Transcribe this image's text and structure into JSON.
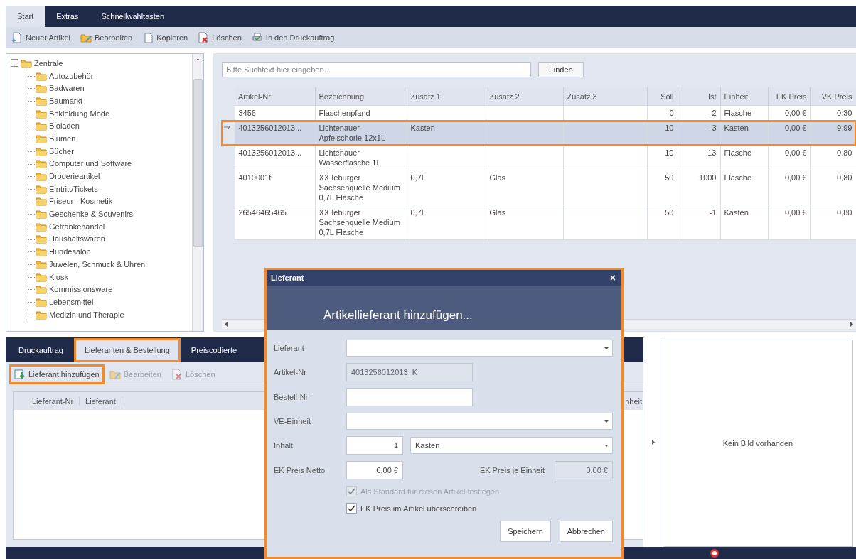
{
  "ribbon_tabs": [
    {
      "label": "Start",
      "selected": true
    },
    {
      "label": "Extras",
      "selected": false
    },
    {
      "label": "Schnellwahltasten",
      "selected": false
    }
  ],
  "toolbar": [
    {
      "label": "Neuer Artikel",
      "kind": "new"
    },
    {
      "label": "Bearbeiten",
      "kind": "edit"
    },
    {
      "label": "Kopieren",
      "kind": "copy"
    },
    {
      "label": "Löschen",
      "kind": "delete"
    },
    {
      "label": "In den Druckauftrag",
      "kind": "print"
    }
  ],
  "tree": [
    {
      "label": "Zentrale",
      "expanded": true,
      "children": [
        {
          "label": "Autozubehör"
        },
        {
          "label": "Badwaren"
        },
        {
          "label": "Baumarkt"
        },
        {
          "label": "Bekleidung Mode"
        },
        {
          "label": "Bioladen"
        },
        {
          "label": "Blumen"
        },
        {
          "label": "Bücher"
        },
        {
          "label": "Computer und Software"
        },
        {
          "label": "Drogerieartikel"
        },
        {
          "label": "Eintritt/Tickets"
        },
        {
          "label": "Friseur - Kosmetik"
        },
        {
          "label": "Geschenke & Souvenirs"
        },
        {
          "label": "Getränkehandel"
        },
        {
          "label": "Haushaltswaren"
        },
        {
          "label": "Hundesalon"
        },
        {
          "label": "Juwelen, Schmuck & Uhren"
        },
        {
          "label": "Kiosk"
        },
        {
          "label": "Kommissionsware"
        },
        {
          "label": "Lebensmittel"
        },
        {
          "label": "Medizin und Therapie"
        }
      ]
    }
  ],
  "search": {
    "placeholder": "Bitte Suchtext hier eingeben...",
    "button": "Finden"
  },
  "articles": {
    "columns": [
      {
        "label": "Artikel-Nr",
        "kind": "text"
      },
      {
        "label": "Bezeichnung",
        "kind": "text"
      },
      {
        "label": "Zusatz 1",
        "kind": "text"
      },
      {
        "label": "Zusatz 2",
        "kind": "text"
      },
      {
        "label": "Zusatz 3",
        "kind": "text"
      },
      {
        "label": "Soll",
        "kind": "number"
      },
      {
        "label": "Ist",
        "kind": "number"
      },
      {
        "label": "Einheit",
        "kind": "text"
      },
      {
        "label": "EK Preis",
        "kind": "number"
      },
      {
        "label": "VK Preis",
        "kind": "number"
      }
    ],
    "rows": [
      {
        "selected": false,
        "highlighted": false,
        "cells": [
          "3456",
          "Flaschenpfand",
          null,
          null,
          null,
          "0",
          "-2",
          "Flasche",
          "0,00 €",
          "0,30"
        ]
      },
      {
        "selected": true,
        "highlighted": true,
        "cells": [
          "4013256012013...",
          "Lichtenauer Apfelschorle 12x1L",
          "Kasten",
          null,
          null,
          "10",
          "-3",
          "Kasten",
          "0,00 €",
          "9,99"
        ]
      },
      {
        "selected": false,
        "highlighted": false,
        "cells": [
          "4013256012013...",
          "Lichtenauer Wasserflasche 1L",
          null,
          null,
          null,
          "10",
          "13",
          "Flasche",
          "0,00 €",
          "0,80"
        ]
      },
      {
        "selected": false,
        "highlighted": false,
        "cells": [
          "4010001f",
          "XX Ieburger Sachsenquelle Medium 0,7L Flasche",
          "0,7L",
          "Glas",
          null,
          "50",
          "1000",
          "Flasche",
          "0,00 €",
          "0,80"
        ]
      },
      {
        "selected": false,
        "highlighted": false,
        "cells": [
          "26546465465",
          "XX Ieburger Sachsenquelle Medium 0,7L Flasche",
          "0,7L",
          "Glas",
          null,
          "50",
          "-1",
          "Kasten",
          "0,00 €",
          "0,80"
        ]
      }
    ]
  },
  "detail_tabs": [
    {
      "label": "Druckauftrag",
      "selected": false,
      "highlighted": false
    },
    {
      "label": "Lieferanten & Bestellung",
      "selected": true,
      "highlighted": true
    },
    {
      "label": "Preiscodierte",
      "selected": false,
      "highlighted": false
    }
  ],
  "detail_toolbar": [
    {
      "label": "Lieferant hinzufügen",
      "kind": "add",
      "disabled": false,
      "highlighted": true
    },
    {
      "label": "Bearbeiten",
      "kind": "edit",
      "disabled": true,
      "highlighted": false
    },
    {
      "label": "Löschen",
      "kind": "delete",
      "disabled": true,
      "highlighted": false
    }
  ],
  "supplier_table": {
    "columns": [
      "Lieferant-Nr",
      "Lieferant",
      "nheit"
    ]
  },
  "image_panel": {
    "text": "Kein Bild vorhanden"
  },
  "dialog": {
    "title": "Lieferant",
    "close": "×",
    "heading": "Artikellieferant hinzufügen...",
    "highlighted": true,
    "fields": [
      {
        "kind": "combo",
        "label": "Lieferant"
      },
      {
        "kind": "text",
        "label": "Artikel-Nr",
        "value": "4013256012013_K",
        "disabled": true
      },
      {
        "kind": "text",
        "label": "Bestell-Nr",
        "disabled": false
      },
      {
        "kind": "combo",
        "label": "VE-Einheit"
      },
      {
        "kind": "quantity",
        "label": "Inhalt",
        "value": "1",
        "unit": "Kasten"
      },
      {
        "kind": "price",
        "label": "EK Preis Netto",
        "value": "0,00 €",
        "unit_label": "EK Preis je Einheit",
        "unit_value": "0,00 €",
        "unit_disabled": true
      }
    ],
    "checkboxes": [
      {
        "label": "Als Standard für diesen Artikel festlegen",
        "checked": true,
        "disabled": true
      },
      {
        "label": "EK Preis im Artikel überschreiben",
        "checked": true,
        "disabled": false
      }
    ],
    "buttons": [
      "Speichern",
      "Abbrechen"
    ]
  }
}
